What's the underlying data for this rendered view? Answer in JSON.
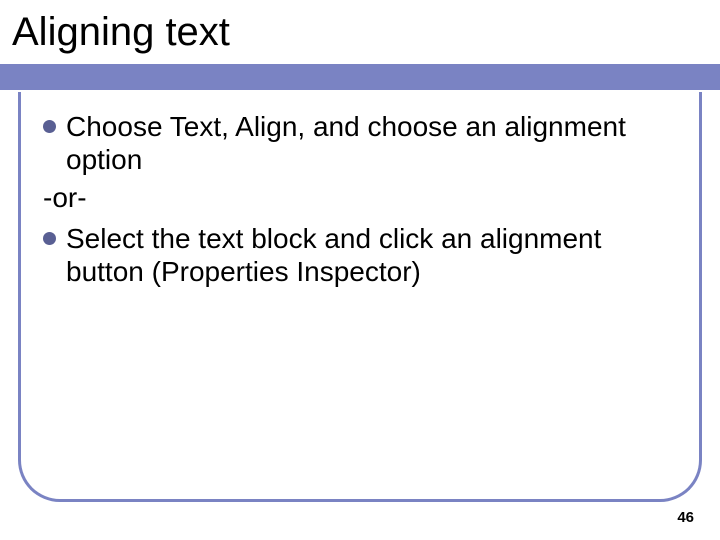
{
  "title": "Aligning text",
  "bullets": [
    "Choose Text, Align, and choose an alignment option",
    "Select the text block and click an alignment button (Properties Inspector)"
  ],
  "separator": "-or-",
  "page_number": "46",
  "colors": {
    "band": "#7a83c3",
    "bullet": "#595f93"
  }
}
